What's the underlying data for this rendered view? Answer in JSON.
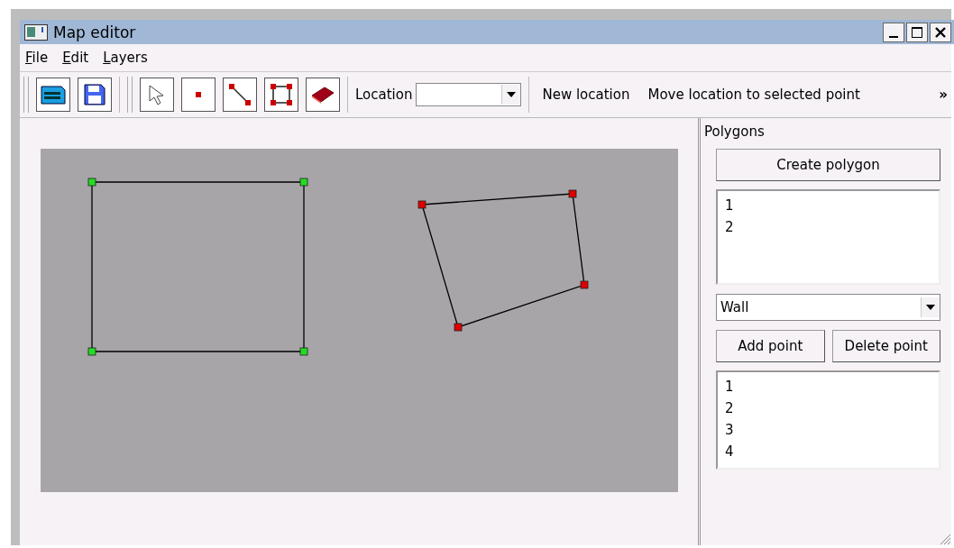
{
  "window": {
    "title": "Map editor"
  },
  "menu": [
    {
      "label": "File"
    },
    {
      "label": "Edit"
    },
    {
      "label": "Layers"
    }
  ],
  "toolbar": {
    "location_label": "Location",
    "actions": [
      "New location",
      "Move location to selected point"
    ],
    "overflow": "»"
  },
  "tools": [
    {
      "kind": "pointer",
      "selected": false
    },
    {
      "kind": "point",
      "selected": false
    },
    {
      "kind": "line",
      "selected": false
    },
    {
      "kind": "polygon",
      "selected": false
    },
    {
      "kind": "eraser",
      "selected": false
    }
  ],
  "canvas": {
    "polygons": [
      {
        "selected": false
      },
      {
        "selected": true
      }
    ]
  },
  "panel": {
    "title": "Polygons",
    "create_button": "Create polygon",
    "polygon_list": [
      "1",
      "2"
    ],
    "type_value": "Wall",
    "add_button": "Add point",
    "delete_button": "Delete point",
    "point_list": [
      "1",
      "2",
      "3",
      "4"
    ]
  }
}
